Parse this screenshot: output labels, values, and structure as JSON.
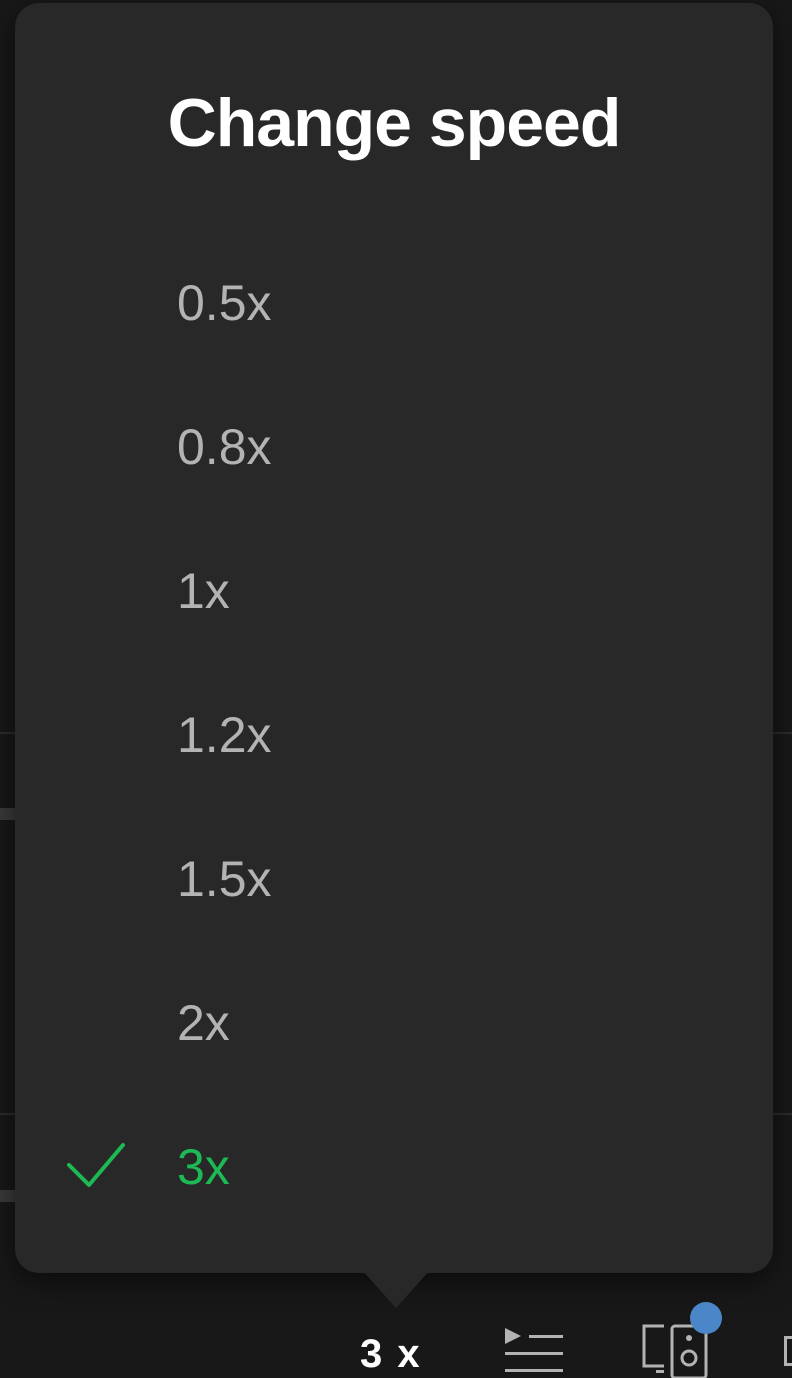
{
  "popup": {
    "title": "Change speed",
    "options": [
      {
        "label": "0.5x",
        "selected": false
      },
      {
        "label": "0.8x",
        "selected": false
      },
      {
        "label": "1x",
        "selected": false
      },
      {
        "label": "1.2x",
        "selected": false
      },
      {
        "label": "1.5x",
        "selected": false
      },
      {
        "label": "2x",
        "selected": false
      },
      {
        "label": "3x",
        "selected": true
      }
    ]
  },
  "controls": {
    "speed_button_label": "3 x",
    "queue_icon": "queue-icon",
    "devices_icon": "devices-icon",
    "devices_badge_color": "#4a86c8"
  },
  "colors": {
    "accent": "#1db954",
    "popup_bg": "#282828",
    "option_text": "#b3b3b3"
  }
}
